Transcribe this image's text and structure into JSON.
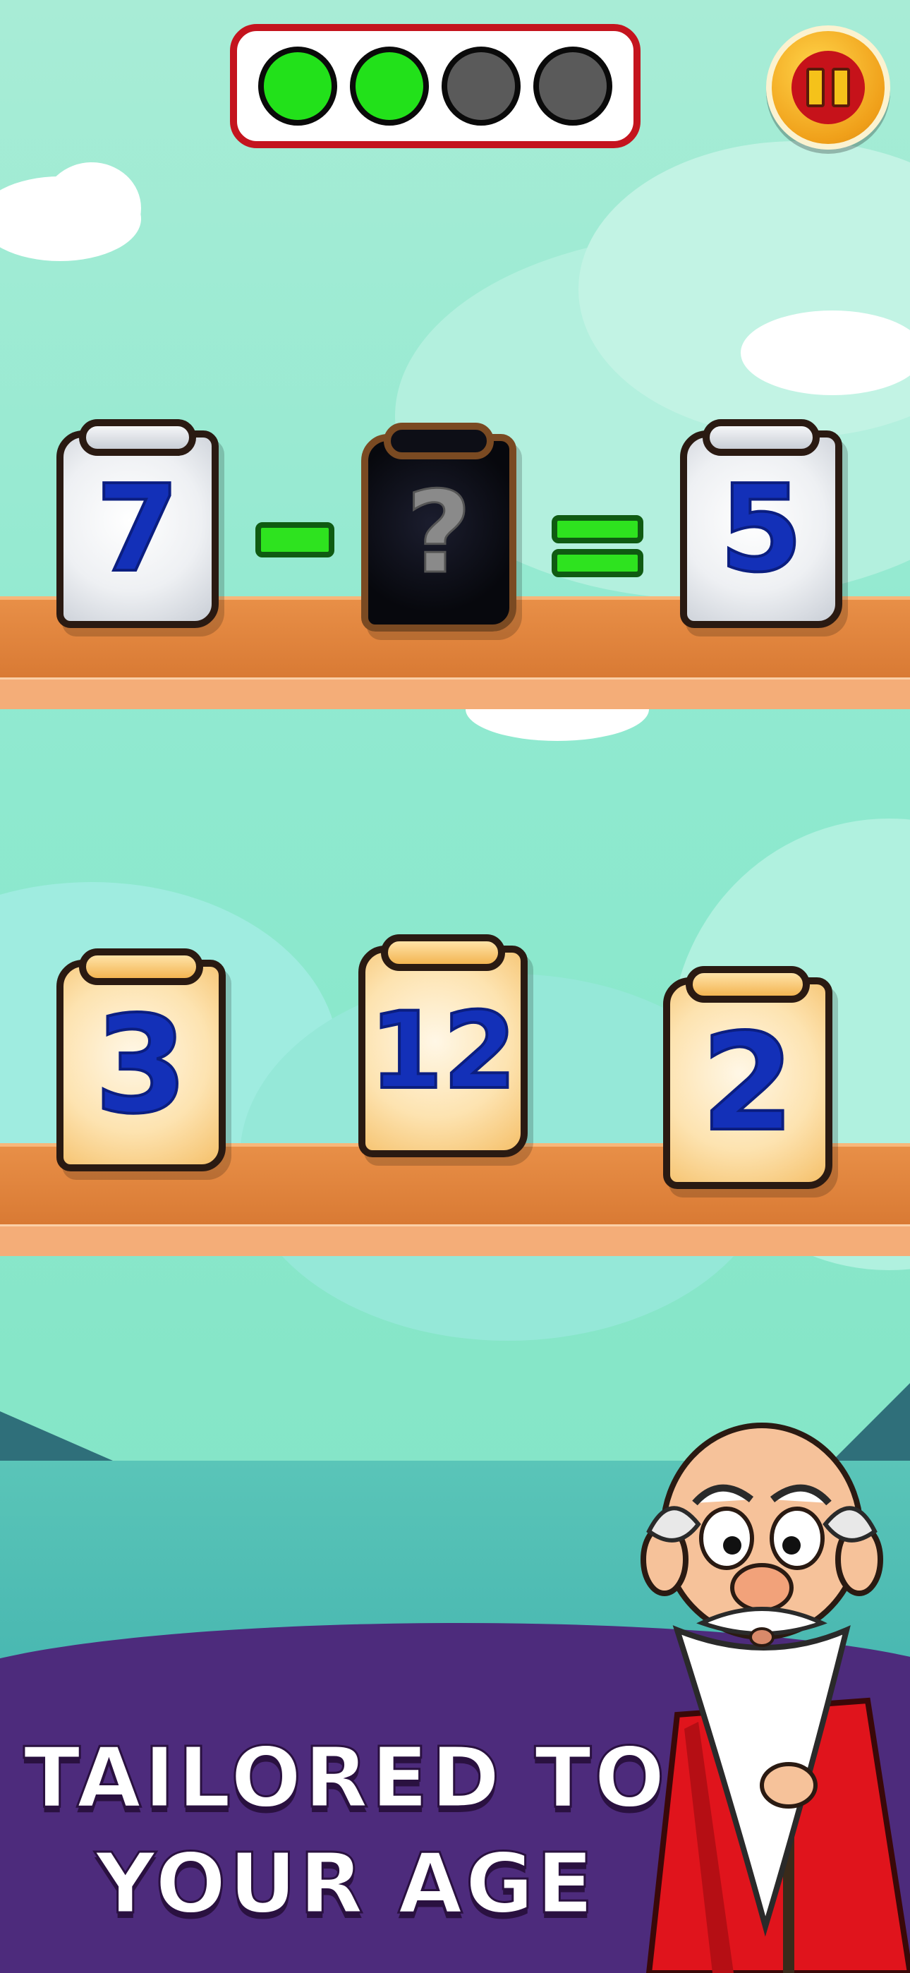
{
  "progress": {
    "dots": [
      {
        "state": "done",
        "color": "#22e11a"
      },
      {
        "state": "done",
        "color": "#22e11a"
      },
      {
        "state": "pending",
        "color": "#5a5a5a"
      },
      {
        "state": "pending",
        "color": "#5a5a5a"
      }
    ]
  },
  "pause_button": {
    "icon": "pause-icon"
  },
  "equation": {
    "left": "7",
    "operator": "-",
    "unknown": "?",
    "equals": "=",
    "result": "5"
  },
  "answers": [
    "3",
    "12",
    "2"
  ],
  "caption": {
    "line1": "TAILORED TO",
    "line2": "YOUR AGE"
  },
  "colors": {
    "number_blue": "#1330b8",
    "operator_green": "#2ee31f",
    "banner_purple": "#4d2b7c",
    "progress_border": "#c4141e"
  }
}
